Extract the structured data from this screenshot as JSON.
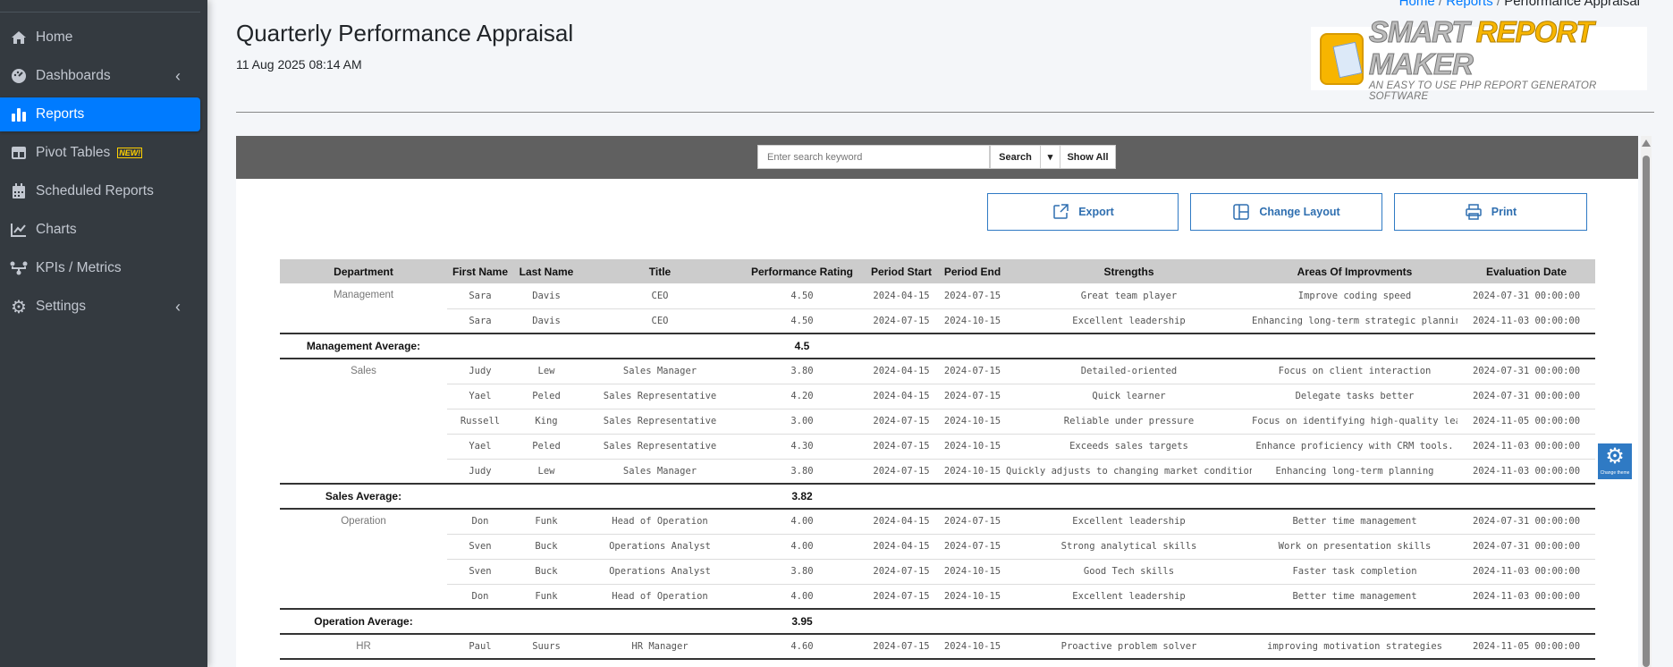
{
  "sidebar": {
    "items": [
      {
        "label": "Home",
        "icon": "home-icon",
        "active": false,
        "chevron": false
      },
      {
        "label": "Dashboards",
        "icon": "dashboard-icon",
        "active": false,
        "chevron": true
      },
      {
        "label": "Reports",
        "icon": "bar-chart-icon",
        "active": true,
        "chevron": false
      },
      {
        "label": "Pivot Tables",
        "icon": "table-icon",
        "active": false,
        "chevron": false,
        "badge": "NEW!"
      },
      {
        "label": "Scheduled Reports",
        "icon": "calendar-icon",
        "active": false,
        "chevron": false
      },
      {
        "label": "Charts",
        "icon": "line-chart-icon",
        "active": false,
        "chevron": false
      },
      {
        "label": "KPIs / Metrics",
        "icon": "network-icon",
        "active": false,
        "chevron": false
      },
      {
        "label": "Settings",
        "icon": "gear-icon",
        "active": false,
        "chevron": true
      }
    ]
  },
  "breadcrumb": {
    "home": "Home",
    "reports": "Reports",
    "current": "Performance Appraisal",
    "sep": "/"
  },
  "header": {
    "title": "Quarterly Performance Appraisal",
    "date": "11 Aug 2025 08:14 AM"
  },
  "logo": {
    "line1a": "SMART",
    "line1b": "REPORT",
    "line1c": "MAKER",
    "line2": "AN EASY TO USE PHP REPORT GENERATOR SOFTWARE"
  },
  "toolbar": {
    "search_placeholder": "Enter search keyword",
    "search_label": "Search",
    "caret": "▾",
    "show_all_label": "Show All"
  },
  "actions": {
    "export": "Export",
    "change_layout": "Change Layout",
    "print": "Print"
  },
  "theme_button": {
    "label": "Change theme"
  },
  "table": {
    "columns": [
      "Department",
      "First Name",
      "Last Name",
      "Title",
      "Performance Rating",
      "Period Start",
      "Period End",
      "Strengths",
      "Areas Of Improvments",
      "Evaluation Date"
    ],
    "groups": [
      {
        "department": "Management",
        "average_label": "Management Average:",
        "average": "4.5",
        "rows": [
          [
            "Sara",
            "Davis",
            "CEO",
            "4.50",
            "2024-04-15",
            "2024-07-15",
            "Great team player",
            "Improve coding speed",
            "2024-07-31 00:00:00"
          ],
          [
            "Sara",
            "Davis",
            "CEO",
            "4.50",
            "2024-07-15",
            "2024-10-15",
            "Excellent leadership",
            "Enhancing long-term strategic planning",
            "2024-11-03 00:00:00"
          ]
        ]
      },
      {
        "department": "Sales",
        "average_label": "Sales Average:",
        "average": "3.82",
        "rows": [
          [
            "Judy",
            "Lew",
            "Sales Manager",
            "3.80",
            "2024-04-15",
            "2024-07-15",
            "Detailed-oriented",
            "Focus on client interaction",
            "2024-07-31 00:00:00"
          ],
          [
            "Yael",
            "Peled",
            "Sales Representative",
            "4.20",
            "2024-04-15",
            "2024-07-15",
            "Quick learner",
            "Delegate tasks better",
            "2024-07-31 00:00:00"
          ],
          [
            "Russell",
            "King",
            "Sales Representative",
            "3.00",
            "2024-07-15",
            "2024-10-15",
            "Reliable under pressure",
            "Focus on identifying high-quality leads",
            "2024-11-05 00:00:00"
          ],
          [
            "Yael",
            "Peled",
            "Sales Representative",
            "4.30",
            "2024-07-15",
            "2024-10-15",
            "Exceeds sales targets",
            "Enhance proficiency with CRM tools.",
            "2024-11-03 00:00:00"
          ],
          [
            "Judy",
            "Lew",
            "Sales Manager",
            "3.80",
            "2024-07-15",
            "2024-10-15",
            "Quickly adjusts to changing market conditions",
            "Enhancing long-term planning",
            "2024-11-03 00:00:00"
          ]
        ]
      },
      {
        "department": "Operation",
        "average_label": "Operation Average:",
        "average": "3.95",
        "rows": [
          [
            "Don",
            "Funk",
            "Head of Operation",
            "4.00",
            "2024-04-15",
            "2024-07-15",
            "Excellent leadership",
            "Better time management",
            "2024-07-31 00:00:00"
          ],
          [
            "Sven",
            "Buck",
            "Operations Analyst",
            "4.00",
            "2024-04-15",
            "2024-07-15",
            "Strong analytical skills",
            "Work on presentation skills",
            "2024-07-31 00:00:00"
          ],
          [
            "Sven",
            "Buck",
            "Operations Analyst",
            "3.80",
            "2024-07-15",
            "2024-10-15",
            "Good Tech skills",
            "Faster task completion",
            "2024-11-03 00:00:00"
          ],
          [
            "Don",
            "Funk",
            "Head of Operation",
            "4.00",
            "2024-07-15",
            "2024-10-15",
            "Excellent leadership",
            "Better time management",
            "2024-11-03 00:00:00"
          ]
        ]
      },
      {
        "department": "HR",
        "rows": [
          [
            "Paul",
            "Suurs",
            "HR Manager",
            "4.60",
            "2024-07-15",
            "2024-10-15",
            "Proactive problem solver",
            "improving motivation strategies",
            "2024-11-05 00:00:00"
          ]
        ]
      }
    ]
  }
}
